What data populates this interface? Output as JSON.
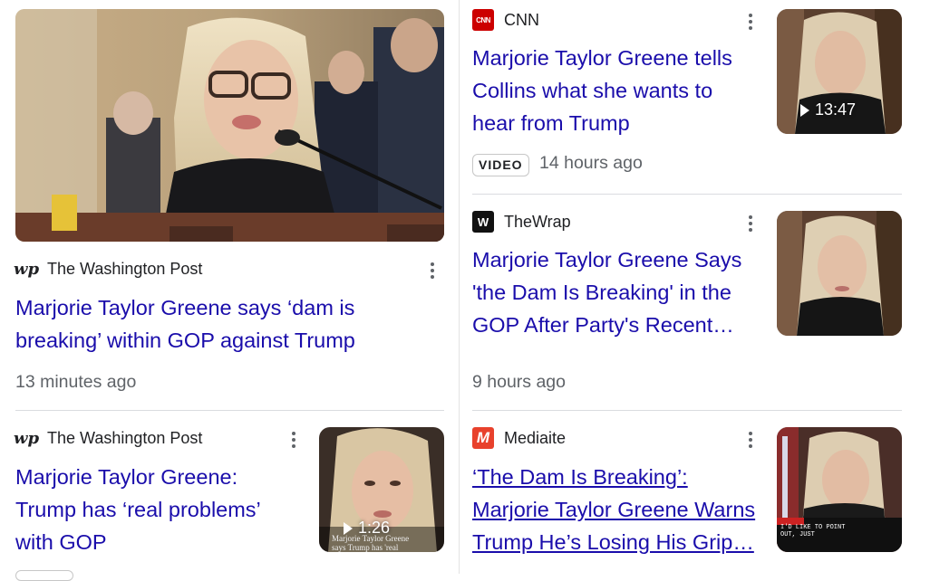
{
  "articles": [
    {
      "source": "The Washington Post",
      "logo_icon": "washington-post-logo-icon",
      "headline": "Marjorie Taylor Greene says ‘dam is breaking’ within GOP against Trump",
      "time": "13 minutes ago"
    },
    {
      "source": "CNN",
      "logo_icon": "cnn-logo-icon",
      "logo_text": "CNN",
      "headline": "Marjorie Taylor Greene tells Collins what she wants to hear from Trump",
      "badge": "VIDEO",
      "time": "14 hours ago",
      "duration": "13:47"
    },
    {
      "source": "TheWrap",
      "logo_icon": "thewrap-logo-icon",
      "logo_text": "W",
      "headline": "Marjorie Taylor Greene Says 'the Dam Is Breaking' in the GOP After Party's Recent…",
      "time": "9 hours ago"
    },
    {
      "source": "The Washington Post",
      "logo_icon": "washington-post-logo-icon",
      "headline": "Marjorie Taylor Greene: Trump has ‘real problems’ with GOP",
      "duration": "1:26",
      "caption_line1": "Marjorie Taylor Greene",
      "caption_line2": "says Trump has 'real"
    },
    {
      "source": "Mediaite",
      "logo_icon": "mediaite-logo-icon",
      "logo_text": "M",
      "headline": "‘The Dam Is Breaking’: Marjorie Taylor Greene Warns Trump He’s Losing His Grip…",
      "chyron_line1": "I'D LIKE TO POINT",
      "chyron_line2": "OUT, JUST"
    }
  ],
  "colors": {
    "link": "#1a0dab",
    "cnn_red": "#cc0000",
    "mediaite_red": "#e8412c"
  }
}
